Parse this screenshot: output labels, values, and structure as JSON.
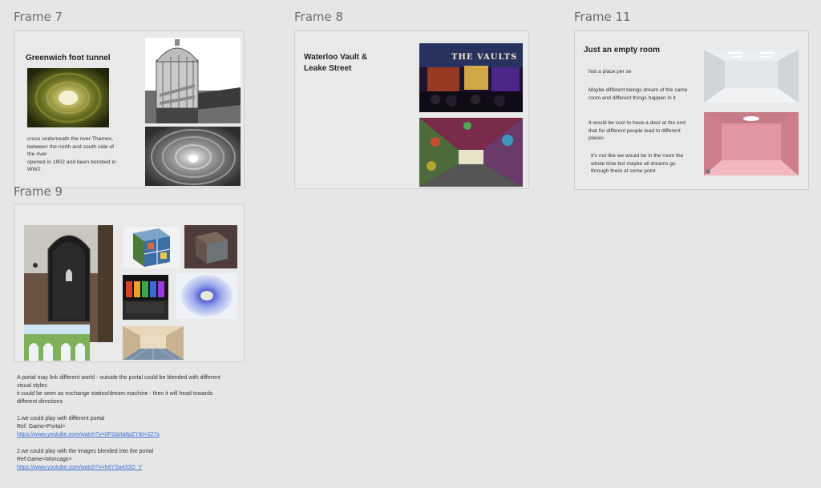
{
  "frames": {
    "f7": {
      "label": "Frame 7",
      "title": "Greenwich foot tunnel",
      "desc": [
        "cross underneath the river Thames,",
        "between the north and south side of",
        "the river",
        "opened in 1902 and been bombed in",
        "WW2"
      ]
    },
    "f8": {
      "label": "Frame 8",
      "title": [
        "Waterloo Vault &",
        "Leake Street"
      ],
      "sign": "THE VAULTS"
    },
    "f11": {
      "label": "Frame 11",
      "title": "Just an empty room",
      "notes": [
        "Not a place per se",
        "Maybe different beings dream of the same room and different things happen in it",
        "It would be cool to have a door at the end that for different people lead to different places",
        "It's not like we would be in the room the whole time but maybe all dreams go through there at some point"
      ]
    },
    "f9": {
      "label": "Frame 9"
    }
  },
  "description": {
    "line1": "A portal may link different world - outside the portal could be blended with different",
    "line2": "visual styles",
    "line3": "it could be seen as exchange station/dream machine - then it will head towards",
    "line4": "different directions",
    "item1": "1.we could play with different portal",
    "item1_ref": "Ref: Game<Portal>",
    "item1_link": "https://www.youtube.com/watch?v=0P2dzta6pZY&t=227s",
    "item2": "2.we could play with the images blended into the portal",
    "item2_ref": "Ref:Game<Moncage>",
    "item2_link": "https://www.youtube.com/watch?v=h6YSa433O_Y"
  },
  "colors": {
    "canvas": "#e6e6e6",
    "frame_bg": "#e9e9e9",
    "link": "#3b6fd4"
  }
}
